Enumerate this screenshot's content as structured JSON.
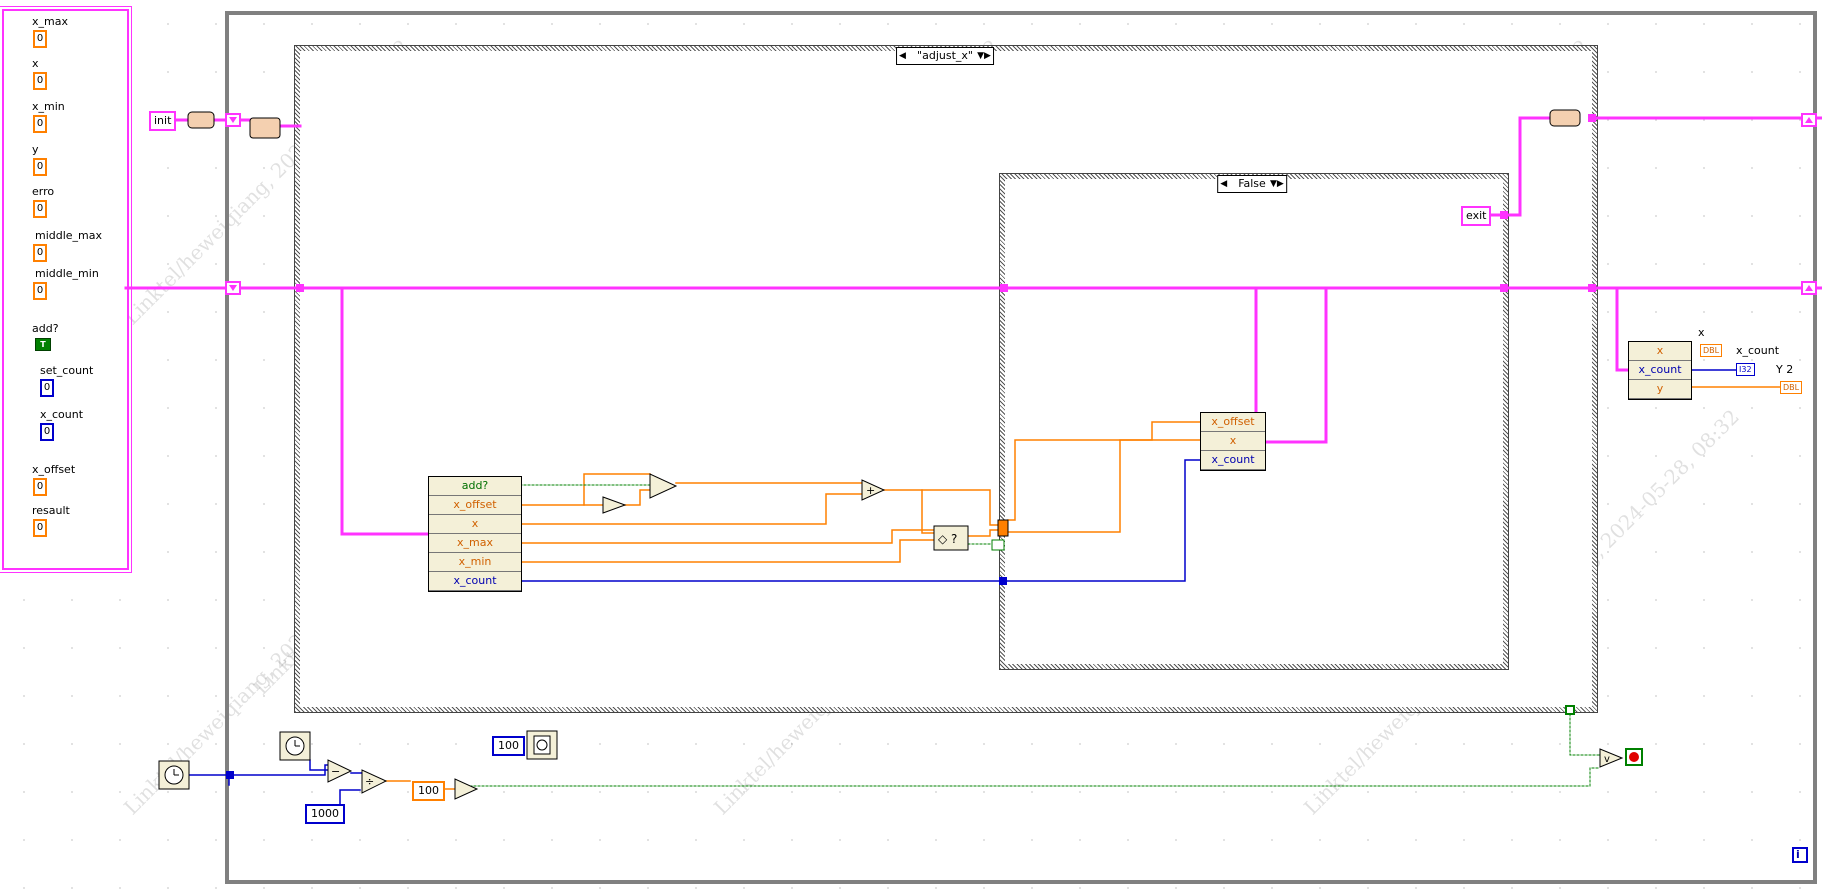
{
  "cluster": {
    "items": [
      {
        "label": "x_max",
        "value": "0",
        "kind": "num"
      },
      {
        "label": "x",
        "value": "0",
        "kind": "num"
      },
      {
        "label": "x_min",
        "value": "0",
        "kind": "num"
      },
      {
        "label": "y",
        "value": "0",
        "kind": "num"
      },
      {
        "label": "erro",
        "value": "0",
        "kind": "num"
      },
      {
        "label": "middle_max",
        "value": "0",
        "kind": "num"
      },
      {
        "label": "middle_min",
        "value": "0",
        "kind": "num"
      },
      {
        "label": "add?",
        "value": "T",
        "kind": "bool"
      },
      {
        "label": "set_count",
        "value": "0",
        "kind": "int"
      },
      {
        "label": "x_count",
        "value": "0",
        "kind": "int"
      },
      {
        "label": "x_offset",
        "value": "0",
        "kind": "num"
      },
      {
        "label": "resault",
        "value": "0",
        "kind": "num"
      }
    ]
  },
  "init_label": "init",
  "exit_label": "exit",
  "outer_case_selector": "\"adjust_x\"",
  "inner_case_selector": "False",
  "unbundle_left": [
    "add?",
    "x_offset",
    "x",
    "x_max",
    "x_min",
    "x_count"
  ],
  "bundle_mid": [
    "x_offset",
    "x",
    "x_count"
  ],
  "unbundle_right": [
    "x",
    "x_count",
    "y"
  ],
  "right_labels": {
    "x": "x",
    "x_count": "x_count",
    "y2": "Y 2"
  },
  "terminals": {
    "dbl": "DBL",
    "i32": "I32"
  },
  "constants": {
    "wait": "100",
    "ms": "1000",
    "compare": "100"
  },
  "iteration": "i",
  "watermark": "Linktel/heweiqiang, 2024-05-28, 08:32",
  "colors": {
    "pink": "#ff33ff",
    "orange": "#ff8000",
    "blue": "#0000cc",
    "green": "#008000",
    "gray": "#808080"
  }
}
